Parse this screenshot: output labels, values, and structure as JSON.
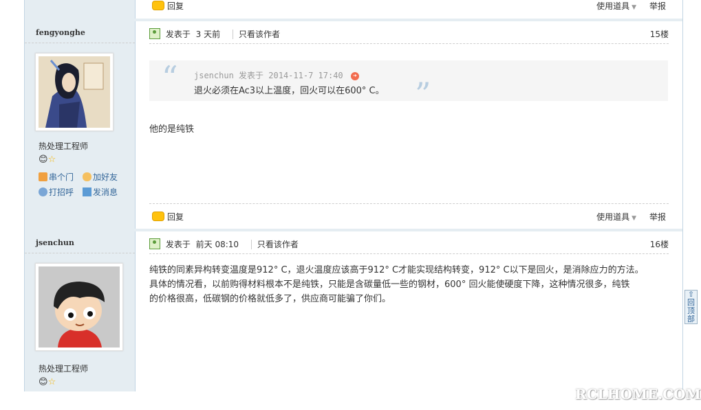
{
  "top_footer": {
    "reply": "回复",
    "tools": "使用道具",
    "report": "举报"
  },
  "posts": [
    {
      "username": "fengyonghe",
      "rank": "热处理工程师",
      "links": {
        "visit": "串个门",
        "add_friend": "加好友",
        "greet": "打招呼",
        "message": "发消息"
      },
      "posted_label": "发表于",
      "posted_time": "3 天前",
      "only_author": "只看该作者",
      "floor": "15楼",
      "quote": {
        "author": "jsenchun",
        "posted_label": "发表于",
        "time": "2014-11-7 17:40",
        "text": "退火必须在Ac3以上温度，回火可以在600° C。"
      },
      "content": "他的是纯铁",
      "footer": {
        "reply": "回复",
        "tools": "使用道具",
        "report": "举报"
      }
    },
    {
      "username": "jsenchun",
      "rank": "热处理工程师",
      "posted_label": "发表于",
      "posted_time": "前天 08:10",
      "only_author": "只看该作者",
      "floor": "16楼",
      "content_lines": [
        "纯铁的同素异构转变温度是912° C，退火温度应该高于912° C才能实现结构转变，912° C以下是回火，是消除应力的方法。",
        "具体的情况看，以前购得材料根本不是纯铁，只能是含碳量低一些的钢材，600° 回火能使硬度下降，这种情况很多，纯铁",
        "的价格很高，低碳钢的价格就低多了，供应商可能骗了你们。"
      ]
    }
  ],
  "back_to_top": "回顶部",
  "watermark": "RCLHOME.COM",
  "colors": {
    "sidebar_bg": "#e5edf2",
    "border": "#c2d5e3",
    "link": "#336699",
    "quote_bg": "#f5f5f5"
  }
}
